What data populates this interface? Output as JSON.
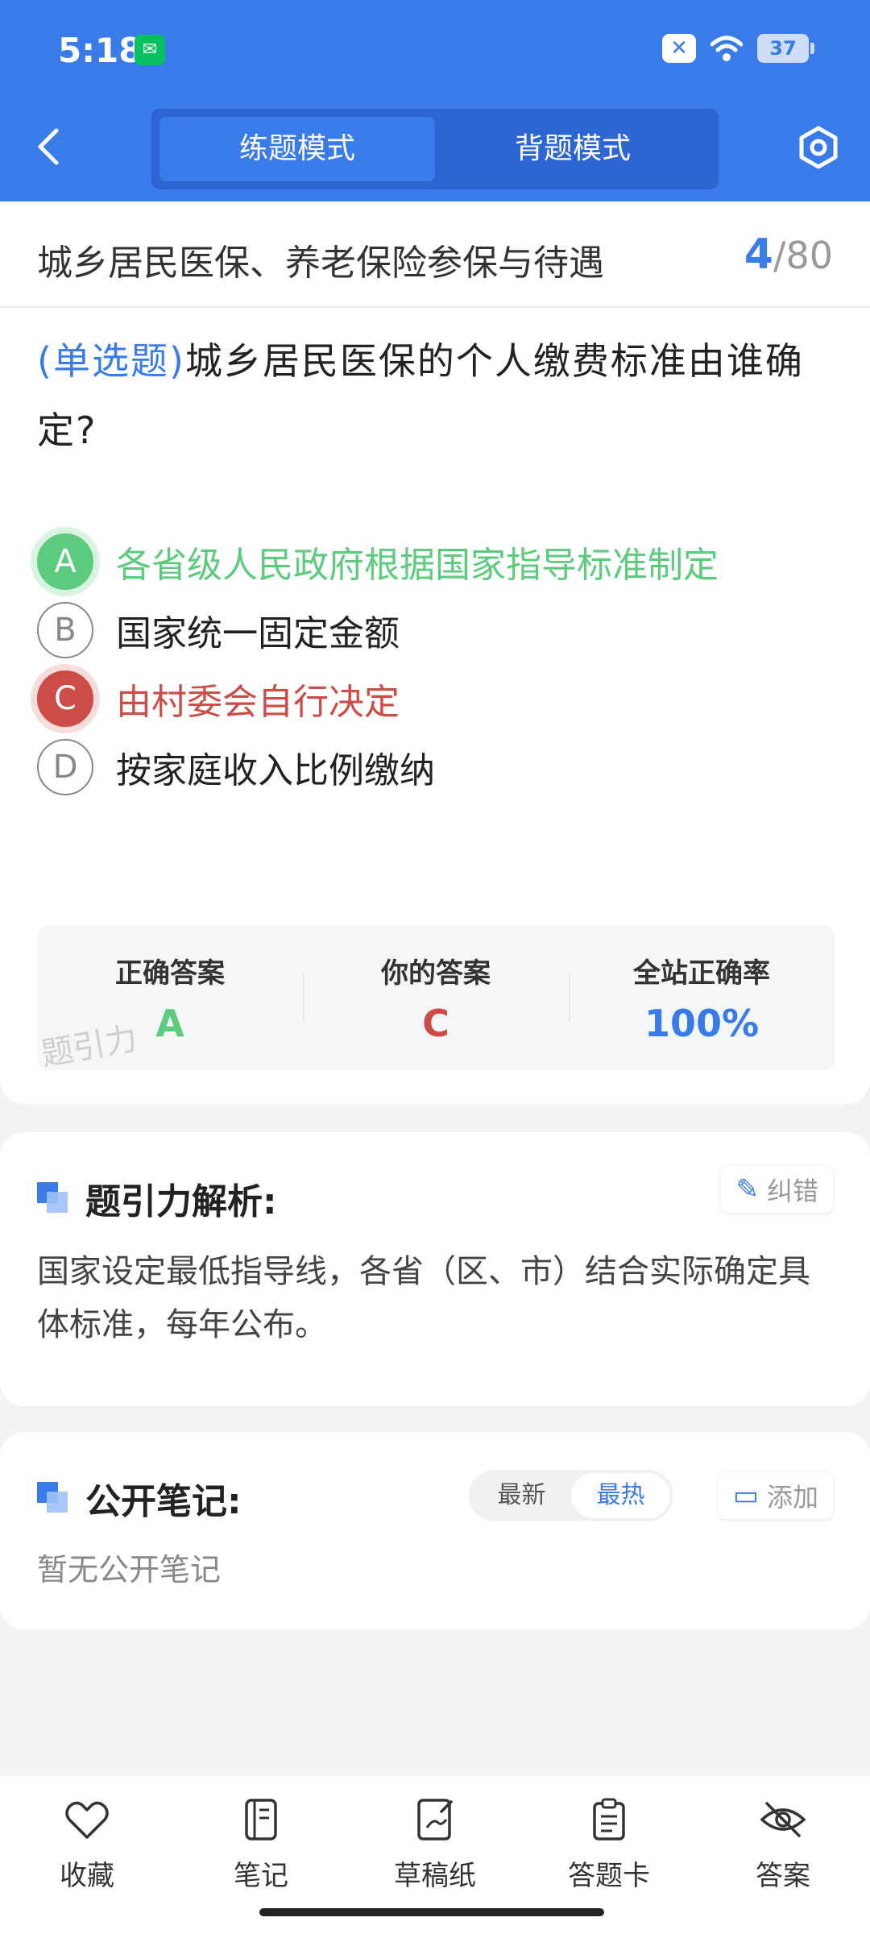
{
  "status_bar": {
    "time": "5:18",
    "battery": "37"
  },
  "header": {
    "tabs": [
      {
        "label": "练题模式",
        "active": true
      },
      {
        "label": "背题模式",
        "active": false
      }
    ]
  },
  "topic": {
    "title": "城乡居民医保、养老保险参保与待遇",
    "current": "4",
    "separator": "/",
    "total": "80"
  },
  "question": {
    "type": "(单选题)",
    "text": "城乡居民医保的个人缴费标准由谁确定?",
    "options": [
      {
        "letter": "A",
        "text": "各省级人民政府根据国家指导标准制定",
        "state": "correct"
      },
      {
        "letter": "B",
        "text": "国家统一固定金额",
        "state": "normal"
      },
      {
        "letter": "C",
        "text": "由村委会自行决定",
        "state": "wrong"
      },
      {
        "letter": "D",
        "text": "按家庭收入比例缴纳",
        "state": "normal"
      }
    ]
  },
  "answer_summary": {
    "correct_label": "正确答案",
    "correct_value": "A",
    "yours_label": "你的答案",
    "yours_value": "C",
    "rate_label": "全站正确率",
    "rate_value": "100%",
    "watermark": "题引力"
  },
  "analysis": {
    "title": "题引力解析:",
    "report_label": "纠错",
    "text": "国家设定最低指导线，各省（区、市）结合实际确定具体标准，每年公布。"
  },
  "notes": {
    "title": "公开笔记:",
    "sort_options": [
      "最新",
      "最热"
    ],
    "active_sort": "最热",
    "add_label": "添加",
    "empty_text": "暂无公开笔记"
  },
  "bottom_nav": [
    {
      "label": "收藏",
      "icon": "heart-icon"
    },
    {
      "label": "笔记",
      "icon": "notebook-icon"
    },
    {
      "label": "草稿纸",
      "icon": "draft-icon"
    },
    {
      "label": "答题卡",
      "icon": "clipboard-icon"
    },
    {
      "label": "答案",
      "icon": "eye-off-icon"
    }
  ],
  "colors": {
    "primary": "#3a7bea",
    "correct": "#5ccb7d",
    "wrong": "#cd4c48"
  }
}
